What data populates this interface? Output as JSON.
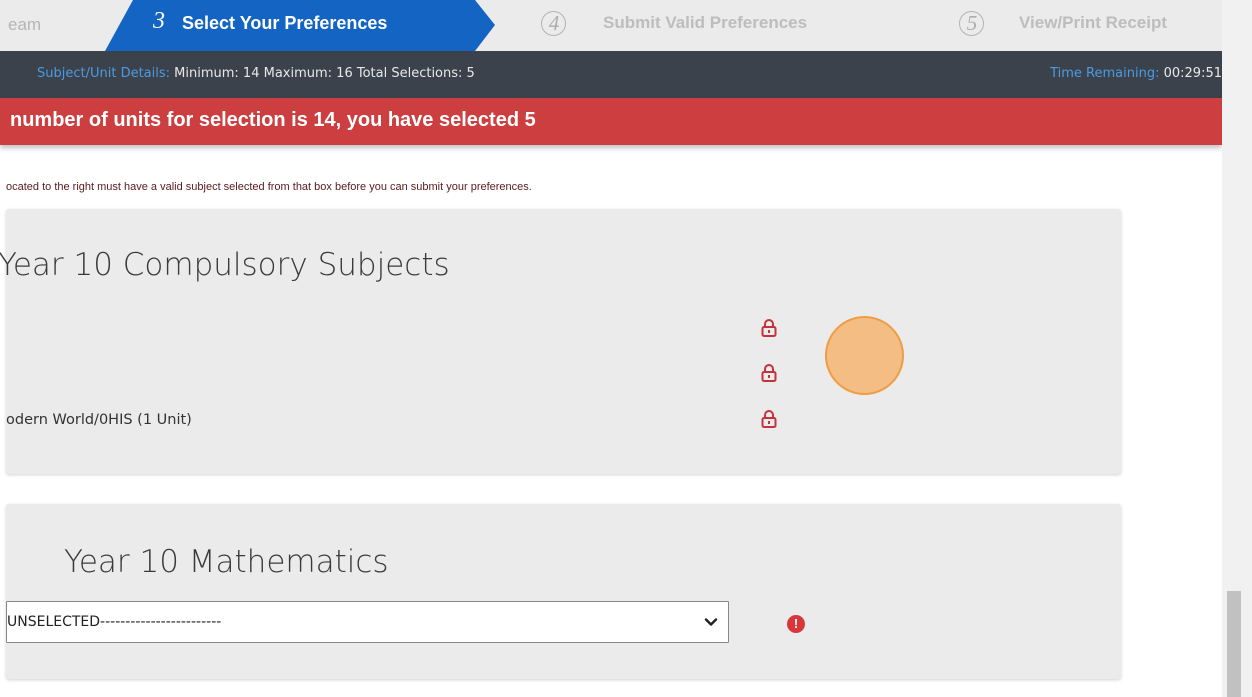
{
  "steps": {
    "prev_label": "eam",
    "active": {
      "number": "3",
      "label": "Select Your Preferences"
    },
    "step4": {
      "number": "4",
      "label": "Submit Valid Preferences"
    },
    "step5": {
      "number": "5",
      "label": "View/Print Receipt"
    }
  },
  "info_bar": {
    "subject_key": "Subject/Unit Details:",
    "subject_value": "Minimum: 14 Maximum: 16 Total Selections: 5",
    "time_key": "Time Remaining:",
    "time_value": "00:29:51"
  },
  "alert": {
    "message": "number of units for selection is 14, you have selected 5"
  },
  "note": "ocated to the right must have a valid subject selected from that box before you can submit your preferences.",
  "compulsory": {
    "title": "Year 10 Compulsory Subjects",
    "subject_text": "odern World/0HIS (1 Unit)",
    "lock_icons": [
      "lock-icon",
      "lock-icon",
      "lock-icon"
    ]
  },
  "mathematics": {
    "title": "Year 10 Mathematics",
    "select_value": "UNSELECTED------------------------",
    "error_icon": "exclamation-circle-icon"
  },
  "colors": {
    "active_step": "#1464c4",
    "info_bar": "#3b424b",
    "info_key": "#4b9be0",
    "alert": "#cc3e3f",
    "lock": "#c4323c",
    "cursor": "#f6aa5a"
  }
}
